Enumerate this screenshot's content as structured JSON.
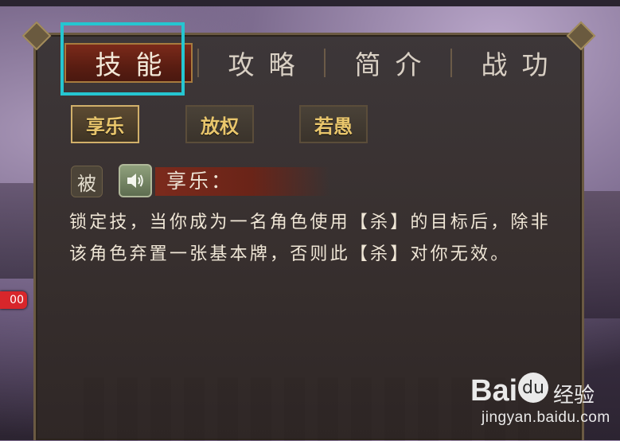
{
  "tabs": [
    {
      "label": "技能",
      "active": true
    },
    {
      "label": "攻略",
      "active": false
    },
    {
      "label": "简介",
      "active": false
    },
    {
      "label": "战功",
      "active": false
    }
  ],
  "skills": [
    {
      "label": "享乐",
      "active": true
    },
    {
      "label": "放权",
      "active": false
    },
    {
      "label": "若愚",
      "active": false
    }
  ],
  "skill_detail": {
    "type_tag": "被",
    "audio_icon": "speaker-icon",
    "title": "享乐：",
    "description": "锁定技，当你成为一名角色使用【杀】的目标后，除非该角色弃置一张基本牌，否则此【杀】对你无效。"
  },
  "side_badge": "00",
  "watermark": {
    "brand": "Bai",
    "paw": "du",
    "cn": "经验",
    "url": "jingyan.baidu.com"
  },
  "colors": {
    "highlight": "#25c6d1",
    "active_tab": "#5a1d12",
    "skill_text": "#e9c66c"
  }
}
